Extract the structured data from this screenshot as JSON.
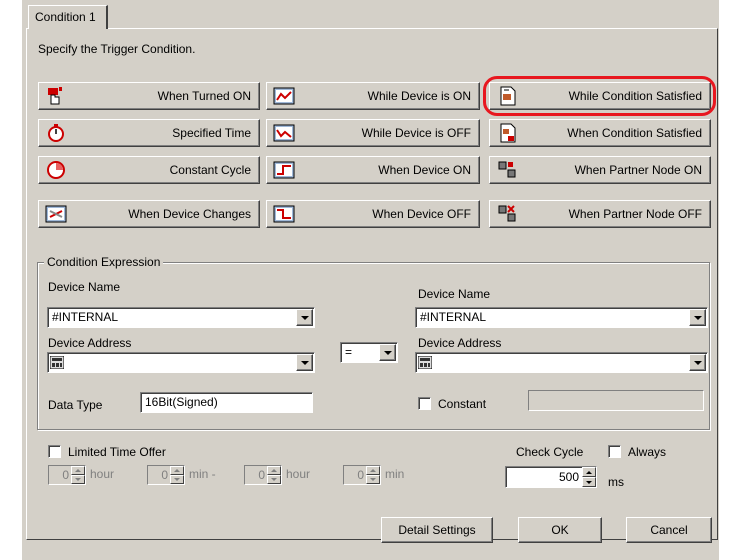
{
  "tab": {
    "label": "Condition 1"
  },
  "instruction": "Specify the Trigger Condition.",
  "trigger_buttons": [
    {
      "label": "When Turned ON"
    },
    {
      "label": "While Device is ON"
    },
    {
      "label": "While Condition Satisfied"
    },
    {
      "label": "Specified Time"
    },
    {
      "label": "While Device is OFF"
    },
    {
      "label": "When Condition Satisfied"
    },
    {
      "label": "Constant Cycle"
    },
    {
      "label": "When Device ON"
    },
    {
      "label": "When Partner Node ON"
    },
    {
      "label": "When Device Changes"
    },
    {
      "label": "When Device OFF"
    },
    {
      "label": "When Partner Node OFF"
    }
  ],
  "highlight_color": "#e8171f",
  "condition_expression": {
    "legend": "Condition Expression",
    "left": {
      "device_name_label": "Device Name",
      "device_name_value": "#INTERNAL",
      "device_address_label": "Device Address",
      "device_address_value": ""
    },
    "operator": "=",
    "right": {
      "device_name_label": "Device Name",
      "device_name_value": "#INTERNAL",
      "device_address_label": "Device Address",
      "device_address_value": ""
    },
    "data_type_label": "Data Type",
    "data_type_value": "16Bit(Signed)",
    "constant_label": "Constant",
    "constant_value": ""
  },
  "limited_time": {
    "label": "Limited Time Offer",
    "fields": [
      {
        "value": "0",
        "unit": "hour"
      },
      {
        "value": "0",
        "unit": "min -"
      },
      {
        "value": "0",
        "unit": "hour"
      },
      {
        "value": "0",
        "unit": "min"
      }
    ]
  },
  "check_cycle": {
    "label": "Check Cycle",
    "always_label": "Always",
    "value": "500",
    "unit": "ms"
  },
  "footer": {
    "detail_settings": "Detail Settings",
    "ok": "OK",
    "cancel": "Cancel"
  }
}
